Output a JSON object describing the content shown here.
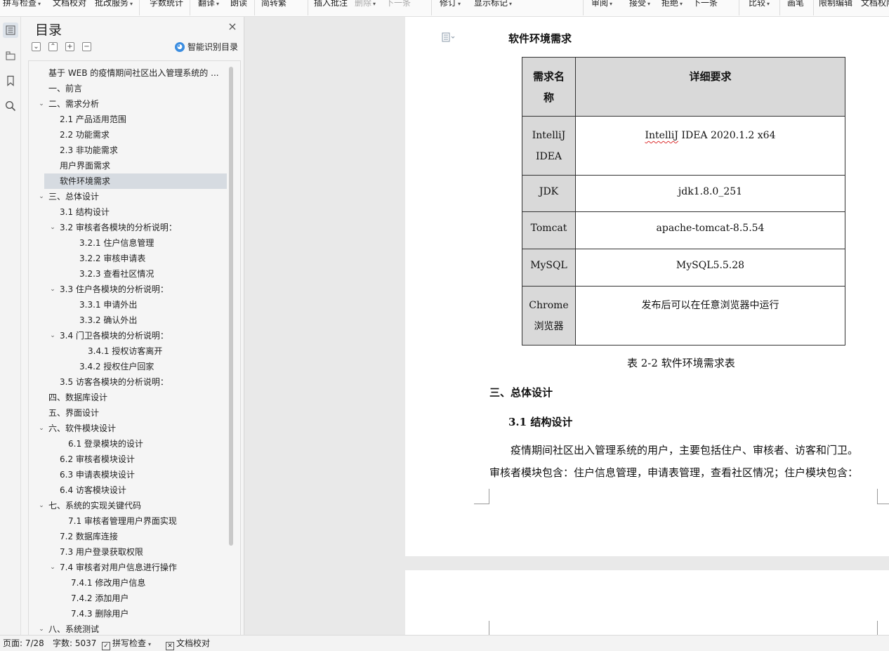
{
  "ribbon": {
    "items": [
      {
        "label": "拼写检查",
        "caret": true
      },
      {
        "label": "文档校对",
        "caret": false
      },
      {
        "label": "批改服务",
        "caret": true
      },
      {
        "label": "字数统计",
        "caret": false
      },
      {
        "label": "翻译",
        "caret": true
      },
      {
        "label": "朗读",
        "caret": false
      },
      {
        "label": "简转繁",
        "caret": false
      },
      {
        "label": "插入批注",
        "caret": false
      },
      {
        "label": "删除",
        "caret": true
      },
      {
        "label": "下一条",
        "caret": false
      },
      {
        "label": "修订",
        "caret": true
      },
      {
        "label": "显示标记",
        "caret": true
      },
      {
        "label": "审阅",
        "caret": true
      },
      {
        "label": "接受",
        "caret": true
      },
      {
        "label": "拒绝",
        "caret": true
      },
      {
        "label": "下一条",
        "caret": false
      },
      {
        "label": "比较",
        "caret": true
      },
      {
        "label": "画笔",
        "caret": false
      },
      {
        "label": "限制编辑",
        "caret": false
      },
      {
        "label": "文档权限",
        "caret": false
      }
    ]
  },
  "rail": {
    "icons": [
      "toc-icon",
      "outline-icon",
      "bookmark-icon",
      "search-icon"
    ]
  },
  "toc": {
    "title": "目录",
    "close": "×",
    "tools": [
      "collapse-all",
      "expand-level",
      "add-heading",
      "remove-heading"
    ],
    "smart_label": "智能识别目录",
    "items": [
      {
        "text": "基于 WEB 的疫情期间社区出入管理系统的 ...",
        "level": 0,
        "toggle": false,
        "sel": false
      },
      {
        "text": "一、前言",
        "level": 0,
        "toggle": false,
        "sel": false
      },
      {
        "text": "二、需求分析",
        "level": 0,
        "toggle": true,
        "sel": false
      },
      {
        "text": "2.1 产品适用范围",
        "level": 1,
        "toggle": false,
        "sel": false
      },
      {
        "text": "2.2 功能需求",
        "level": 1,
        "toggle": false,
        "sel": false
      },
      {
        "text": "2.3 非功能需求",
        "level": 1,
        "toggle": false,
        "sel": false
      },
      {
        "text": "用户界面需求",
        "level": 1,
        "toggle": false,
        "sel": false
      },
      {
        "text": "软件环境需求",
        "level": 1,
        "toggle": false,
        "sel": true
      },
      {
        "text": "三、总体设计",
        "level": 0,
        "toggle": true,
        "sel": false
      },
      {
        "text": "3.1 结构设计",
        "level": 1,
        "toggle": false,
        "sel": false
      },
      {
        "text": "3.2 审核者各模块的分析说明：",
        "level": 1,
        "toggle": true,
        "sel": false
      },
      {
        "text": "3.2.1 住户信息管理",
        "level": 2,
        "toggle": false,
        "sel": false
      },
      {
        "text": "3.2.2  审核申请表",
        "level": 2,
        "toggle": false,
        "sel": false
      },
      {
        "text": "3.2.3  查看社区情况",
        "level": 2,
        "toggle": false,
        "sel": false
      },
      {
        "text": "3.3 住户各模块的分析说明：",
        "level": 1,
        "toggle": true,
        "sel": false
      },
      {
        "text": "3.3.1 申请外出",
        "level": 2,
        "toggle": false,
        "sel": false
      },
      {
        "text": "3.3.2  确认外出",
        "level": 2,
        "toggle": false,
        "sel": false
      },
      {
        "text": "3.4 门卫各模块的分析说明：",
        "level": 1,
        "toggle": true,
        "sel": false
      },
      {
        "text": "3.4.1  授权访客离开",
        "level": 3,
        "toggle": false,
        "sel": false
      },
      {
        "text": "3.4.2  授权住户回家",
        "level": 2,
        "toggle": false,
        "sel": false
      },
      {
        "text": "3.5 访客各模块的分析说明：",
        "level": 1,
        "toggle": false,
        "sel": false
      },
      {
        "text": "四、数据库设计",
        "level": 0,
        "toggle": false,
        "sel": false
      },
      {
        "text": "五、界面设计",
        "level": 0,
        "toggle": false,
        "sel": false
      },
      {
        "text": "六、软件模块设计",
        "level": 0,
        "toggle": true,
        "sel": false
      },
      {
        "text": "6.1 登录模块的设计",
        "level": 4,
        "toggle": false,
        "sel": false
      },
      {
        "text": "6.2 审核者模块设计",
        "level": 1,
        "toggle": false,
        "sel": false
      },
      {
        "text": "6.3 申请表模块设计",
        "level": 1,
        "toggle": false,
        "sel": false
      },
      {
        "text": "6.4 访客模块设计",
        "level": 1,
        "toggle": false,
        "sel": false
      },
      {
        "text": "七、系统的实现关键代码",
        "level": 0,
        "toggle": true,
        "sel": false
      },
      {
        "text": "7.1 审核者管理用户界面实现",
        "level": 4,
        "toggle": false,
        "sel": false
      },
      {
        "text": "7.2  数据库连接",
        "level": 1,
        "toggle": false,
        "sel": false
      },
      {
        "text": "7.3 用户登录获取权限",
        "level": 1,
        "toggle": false,
        "sel": false
      },
      {
        "text": "7.4 审核者对用户信息进行操作",
        "level": 1,
        "toggle": true,
        "sel": false
      },
      {
        "text": "7.4.1  修改用户信息",
        "level": 5,
        "toggle": false,
        "sel": false
      },
      {
        "text": "7.4.2  添加用户",
        "level": 5,
        "toggle": false,
        "sel": false
      },
      {
        "text": "7.4.3  删除用户",
        "level": 5,
        "toggle": false,
        "sel": false
      },
      {
        "text": "八、系统测试",
        "level": 0,
        "toggle": true,
        "sel": false
      }
    ]
  },
  "doc": {
    "section_heading": "软件环境需求",
    "table": {
      "headers": [
        "需求名称",
        "详细要求"
      ],
      "rows": [
        {
          "name": "IntelliJ IDEA",
          "detail": "IntelliJ IDEA 2020.1.2 x64"
        },
        {
          "name": "JDK",
          "detail": "jdk1.8.0_251"
        },
        {
          "name": "Tomcat",
          "detail": "apache-tomcat-8.5.54"
        },
        {
          "name": "MySQL",
          "detail": "MySQL5.5.28"
        },
        {
          "name": "Chrome浏览器",
          "detail": "发布后可以在任意浏览器中运行"
        }
      ]
    },
    "caption": "表 2-2 软件环境需求表",
    "h_total": "三、总体设计",
    "h_31": "3.1 结构设计",
    "para1": "疫情期间社区出入管理系统的用户，主要包括住户、审核者、访客和门卫。",
    "para2": "审核者模块包含：住户信息管理，申请表管理，查看社区情况；住户模块包含："
  },
  "status": {
    "page": "页面: 7/28",
    "words": "字数: 5037",
    "spell": "拼写检查",
    "proof": "文档校对"
  },
  "colors": {
    "accent": "#3b8de0",
    "toc_selected": "#d6dbe1",
    "table_header": "#d9d9d9"
  }
}
